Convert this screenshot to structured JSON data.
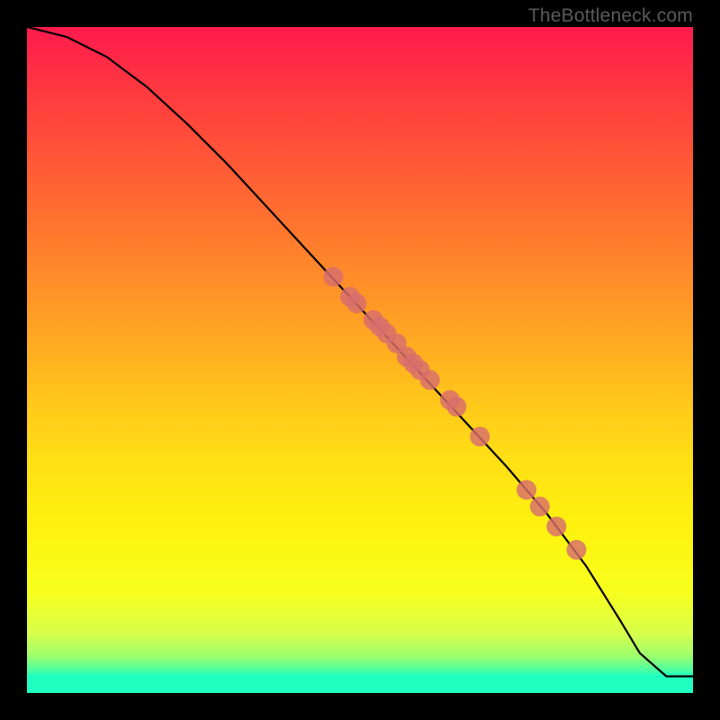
{
  "watermark": "TheBottleneck.com",
  "chart_data": {
    "type": "line",
    "title": "",
    "xlabel": "",
    "ylabel": "",
    "xlim": [
      0,
      100
    ],
    "ylim": [
      0,
      100
    ],
    "grid": false,
    "series": [
      {
        "name": "curve",
        "stroke": "#000000",
        "x": [
          0,
          6,
          12,
          18,
          24,
          30,
          36,
          42,
          48,
          54,
          60,
          66,
          72,
          78,
          84,
          89,
          92,
          96,
          100
        ],
        "y": [
          100,
          98.5,
          95.5,
          91,
          85.5,
          79.5,
          73,
          66.5,
          60,
          53.5,
          47,
          40.5,
          34,
          27,
          19,
          11,
          6,
          2.5,
          2.5
        ]
      }
    ],
    "markers": {
      "name": "highlighted-points",
      "fill": "#d86e6e",
      "radius_px": 11,
      "x": [
        46,
        48.5,
        49.5,
        52,
        53,
        54,
        55.5,
        57,
        58,
        59,
        60.5,
        63.5,
        64.5,
        68,
        75,
        77,
        79.5,
        82.5
      ],
      "y": [
        62.5,
        59.5,
        58.5,
        56,
        55,
        54,
        52.5,
        50.5,
        49.5,
        48.5,
        47,
        44,
        43,
        38.5,
        30.5,
        28,
        25,
        21.5
      ]
    },
    "background_gradient": {
      "direction": "top-to-bottom",
      "stops": [
        {
          "pos": 0.0,
          "color": "#ff1a4d"
        },
        {
          "pos": 0.5,
          "color": "#ffbd20"
        },
        {
          "pos": 0.8,
          "color": "#fdff10"
        },
        {
          "pos": 0.965,
          "color": "#4dffa0"
        },
        {
          "pos": 1.0,
          "color": "#1fffc0"
        }
      ]
    }
  }
}
